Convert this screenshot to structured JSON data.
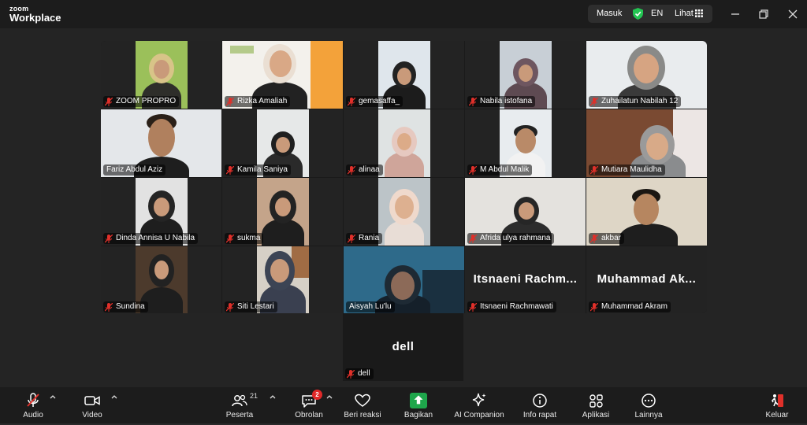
{
  "app": {
    "logo_top": "zoom",
    "logo_bottom": "Workplace"
  },
  "titlebar": {
    "signin": "Masuk",
    "language": "EN",
    "view": "Lihat"
  },
  "colors": {
    "active_speaker": "#3ddc84",
    "share_green": "#1ea64b",
    "badge_red": "#e02828",
    "muted_red": "#e0302a"
  },
  "participants": [
    {
      "name": "ZOOM PROPRO"
    },
    {
      "name": "Rizka Amaliah"
    },
    {
      "name": "gemasaffa_"
    },
    {
      "name": "Nabila istofana"
    },
    {
      "name": "Zuhailatun Nabilah 12"
    },
    {
      "name": "Fariz Abdul Aziz"
    },
    {
      "name": "Kamila Saniya"
    },
    {
      "name": "alinaa"
    },
    {
      "name": "M Abdul Malik"
    },
    {
      "name": "Mutiara Maulidha"
    },
    {
      "name": "Dinda Annisa U Nabila"
    },
    {
      "name": "sukma"
    },
    {
      "name": "Rania"
    },
    {
      "name": "Afrida ulya rahmana"
    },
    {
      "name": "akbar"
    },
    {
      "name": "Sundina"
    },
    {
      "name": "Siti Lestari"
    },
    {
      "name": "Aisyah Lu'lu"
    },
    {
      "name": "Itsnaeni Rachmawati",
      "display": "Itsnaeni  Rachm..."
    },
    {
      "name": "Muhammad Akram",
      "display": "Muhammad  Ak..."
    },
    {
      "name": "dell",
      "display": "dell"
    }
  ],
  "toolbar": {
    "audio": "Audio",
    "video": "Video",
    "participants": "Peserta",
    "participant_count": "21",
    "chat": "Obrolan",
    "chat_badge": "2",
    "reactions": "Beri reaksi",
    "share": "Bagikan",
    "ai": "AI Companion",
    "info": "Info rapat",
    "apps": "Aplikasi",
    "more": "Lainnya",
    "leave": "Keluar"
  }
}
